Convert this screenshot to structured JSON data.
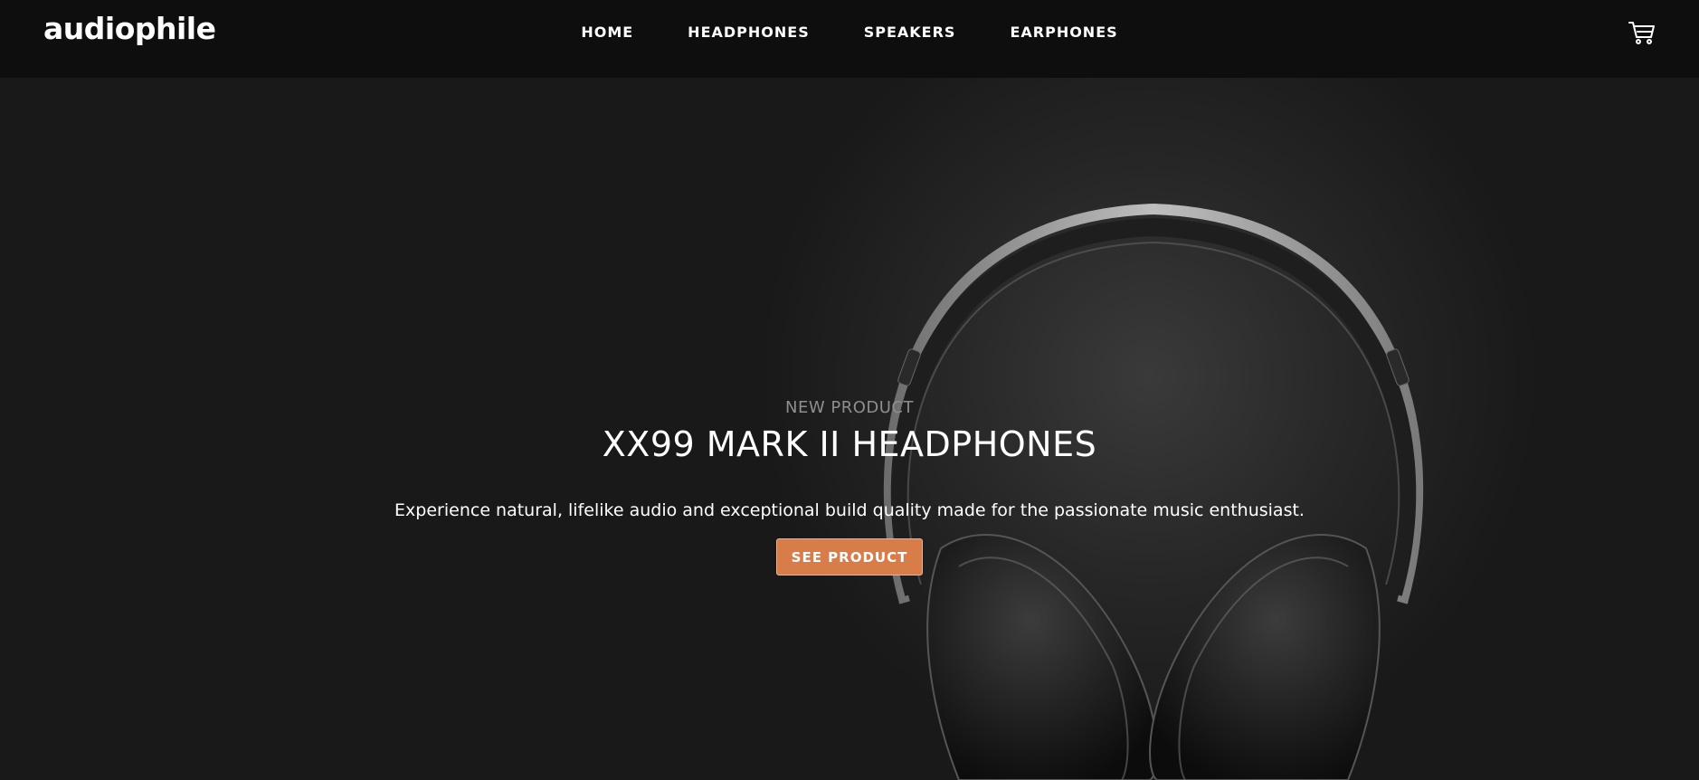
{
  "header": {
    "logo": "audiophile",
    "nav": [
      "HOME",
      "HEADPHONES",
      "SPEAKERS",
      "EARPHONES"
    ],
    "cart_icon": "cart-icon"
  },
  "hero": {
    "overline": "NEW PRODUCT",
    "title": "XX99 MARK II HEADPHONES",
    "description": "Experience natural, lifelike audio and exceptional build quality made for the passionate music enthusiast.",
    "cta_label": "SEE PRODUCT"
  },
  "colors": {
    "accent": "#d87d4a",
    "background": "#191919",
    "header_bg": "#0e0e0e"
  }
}
